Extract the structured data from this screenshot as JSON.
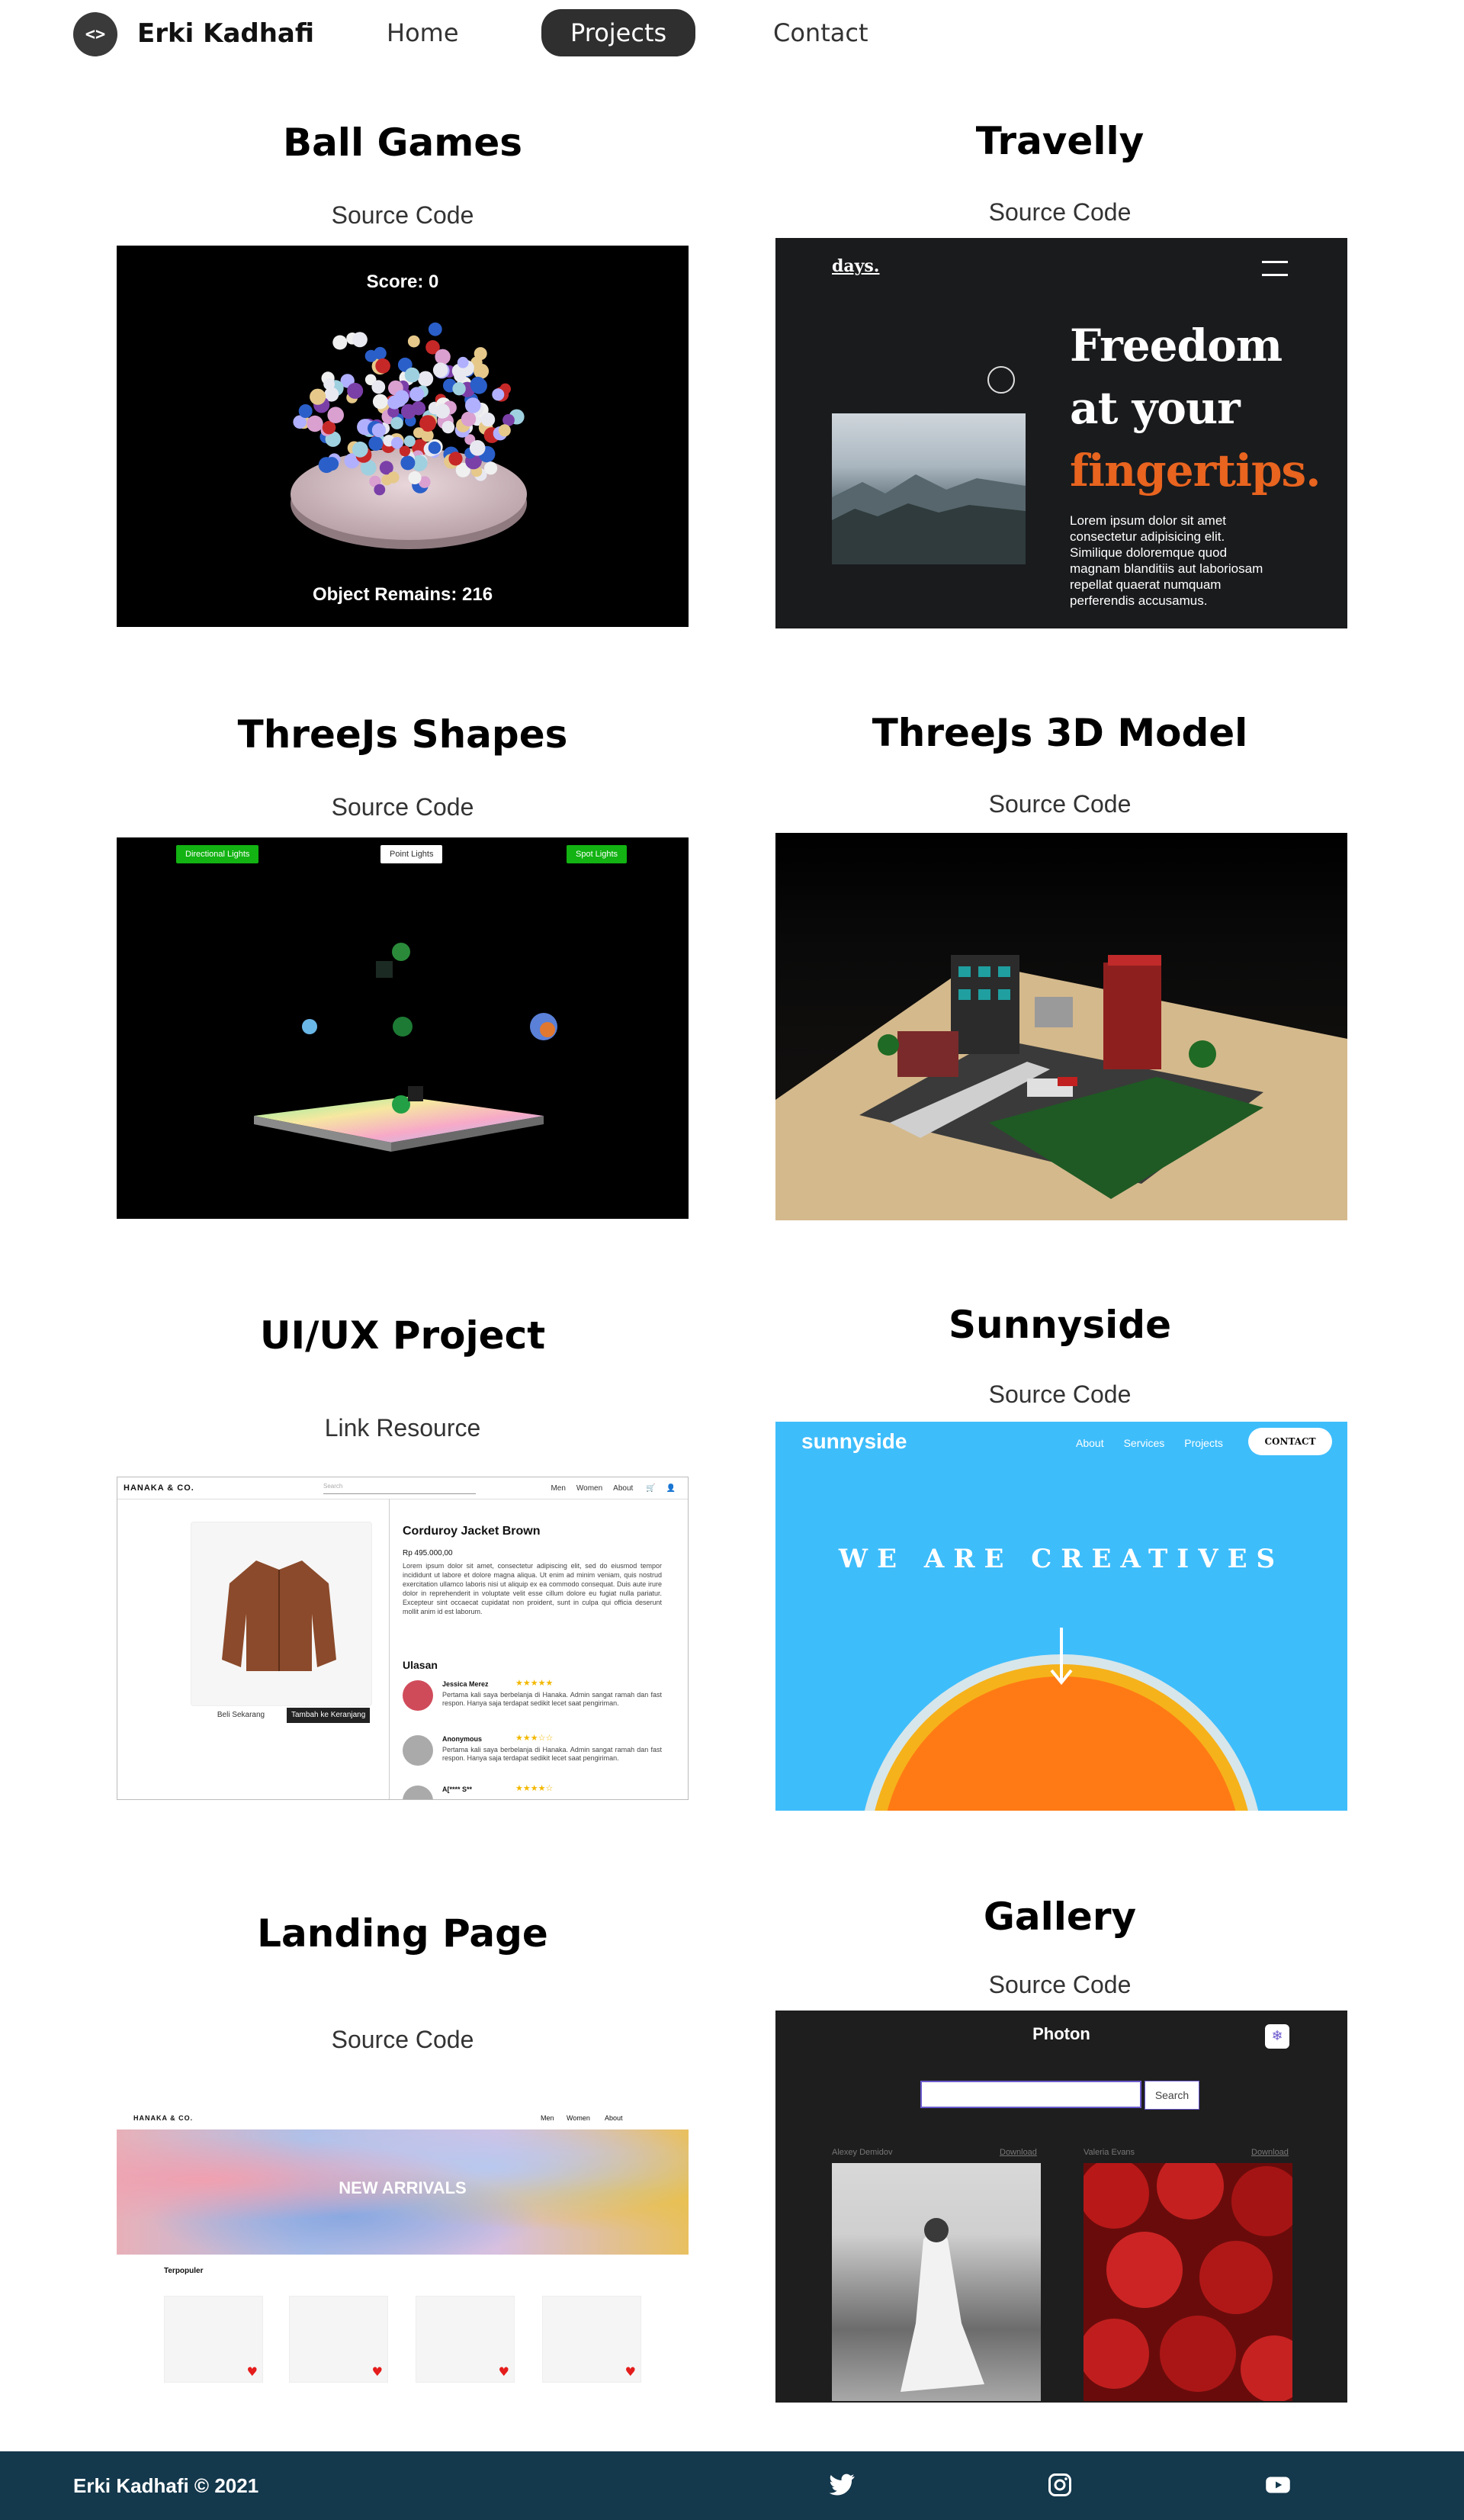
{
  "nav": {
    "logo_text": "<>",
    "brand": "Erki Kadhafi",
    "links": [
      "Home",
      "Projects",
      "Contact"
    ],
    "active": "Projects"
  },
  "projects": [
    {
      "title": "Ball Games",
      "link_label": "Source Code",
      "preview": {
        "score": "Score: 0",
        "remains": "Object Remains: 216"
      }
    },
    {
      "title": "Travelly",
      "link_label": "Source Code",
      "preview": {
        "logo": "days.",
        "headline_1": "Freedom",
        "headline_2": "at your",
        "headline_3": "fingertips.",
        "body": "Lorem ipsum dolor sit amet consectetur adipisicing elit. Similique doloremque quod magnam blanditiis aut laboriosam repellat quaerat numquam perferendis accusamus."
      }
    },
    {
      "title": "ThreeJs Shapes",
      "link_label": "Source Code",
      "preview": {
        "buttons": [
          "Directional Lights",
          "Point Lights",
          "Spot Lights"
        ]
      }
    },
    {
      "title": "ThreeJs 3D Model",
      "link_label": "Source Code"
    },
    {
      "title": "UI/UX Project",
      "link_label": "Link Resource",
      "preview": {
        "brand": "HANAKA & CO.",
        "search_placeholder": "Search",
        "links": [
          "Men",
          "Women",
          "About"
        ],
        "product": "Corduroy Jacket Brown",
        "price": "Rp 495.000,00",
        "desc": "Lorem ipsum dolor sit amet, consectetur adipiscing elit, sed do eiusmod tempor incididunt ut labore et dolore magna aliqua. Ut enim ad minim veniam, quis nostrud exercitation ullamco laboris nisi ut aliquip ex ea commodo consequat. Duis aute irure dolor in reprehenderit in voluptate velit esse cillum dolore eu fugiat nulla pariatur. Excepteur sint occaecat cupidatat non proident, sunt in culpa qui officia deserunt mollit anim id est laborum.",
        "buy_label": "Beli Sekarang",
        "cart_label": "Tambah ke Keranjang",
        "reviews_title": "Ulasan",
        "reviews": [
          {
            "name": "Jessica Merez",
            "stars": "★★★★★",
            "text": "Pertama kali saya berbelanja di Hanaka. Admin sangat ramah dan fast respon. Hanya saja terdapat sedikit lecet saat pengiriman."
          },
          {
            "name": "Anonymous",
            "stars": "★★★☆☆",
            "text": "Pertama kali saya berbelanja di Hanaka. Admin sangat ramah dan fast respon. Hanya saja terdapat sedikit lecet saat pengiriman."
          },
          {
            "name": "A[**** S**",
            "stars": "★★★★☆",
            "text": ""
          }
        ]
      }
    },
    {
      "title": "Sunnyside",
      "link_label": "Source Code",
      "preview": {
        "logo": "sunnyside",
        "links": [
          "About",
          "Services",
          "Projects"
        ],
        "contact": "CONTACT",
        "headline": "WE ARE CREATIVES"
      }
    },
    {
      "title": "Landing Page",
      "link_label": "Source Code",
      "preview": {
        "brand": "HANAKA & CO.",
        "links": [
          "Men",
          "Women",
          "About"
        ],
        "banner": "NEW ARRIVALS",
        "section": "Terpopuler"
      }
    },
    {
      "title": "Gallery",
      "link_label": "Source Code",
      "preview": {
        "title": "Photon",
        "search_button": "Search",
        "photos": [
          {
            "author": "Alexey Demidov",
            "download": "Download"
          },
          {
            "author": "Valeria Evans",
            "download": "Download"
          }
        ]
      }
    }
  ],
  "footer": {
    "copyright": "Erki Kadhafi © 2021",
    "icons": [
      "twitter-icon",
      "instagram-icon",
      "youtube-icon"
    ]
  },
  "colors": {
    "footer_bg": "#14384c",
    "nav_active_bg": "#2f2f2f",
    "travelly_accent": "#e8641f",
    "sunnyside_bg": "#3ebdfb",
    "gallery_accent": "#6a5acd"
  }
}
